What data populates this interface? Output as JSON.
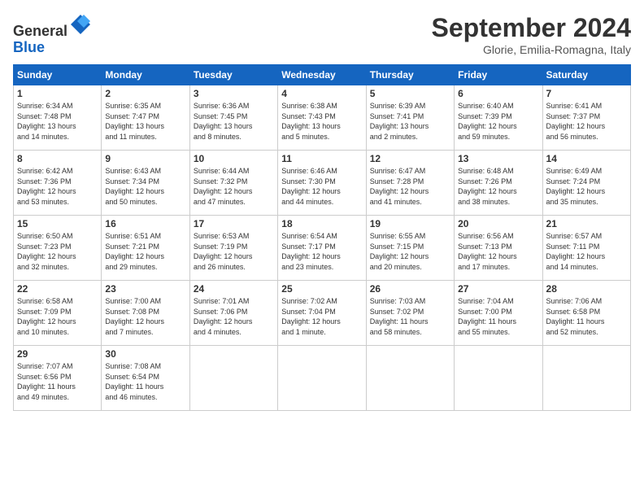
{
  "header": {
    "logo_line1": "General",
    "logo_line2": "Blue",
    "month": "September 2024",
    "location": "Glorie, Emilia-Romagna, Italy"
  },
  "days_of_week": [
    "Sunday",
    "Monday",
    "Tuesday",
    "Wednesday",
    "Thursday",
    "Friday",
    "Saturday"
  ],
  "weeks": [
    [
      {
        "day": "1",
        "info": "Sunrise: 6:34 AM\nSunset: 7:48 PM\nDaylight: 13 hours\nand 14 minutes."
      },
      {
        "day": "2",
        "info": "Sunrise: 6:35 AM\nSunset: 7:47 PM\nDaylight: 13 hours\nand 11 minutes."
      },
      {
        "day": "3",
        "info": "Sunrise: 6:36 AM\nSunset: 7:45 PM\nDaylight: 13 hours\nand 8 minutes."
      },
      {
        "day": "4",
        "info": "Sunrise: 6:38 AM\nSunset: 7:43 PM\nDaylight: 13 hours\nand 5 minutes."
      },
      {
        "day": "5",
        "info": "Sunrise: 6:39 AM\nSunset: 7:41 PM\nDaylight: 13 hours\nand 2 minutes."
      },
      {
        "day": "6",
        "info": "Sunrise: 6:40 AM\nSunset: 7:39 PM\nDaylight: 12 hours\nand 59 minutes."
      },
      {
        "day": "7",
        "info": "Sunrise: 6:41 AM\nSunset: 7:37 PM\nDaylight: 12 hours\nand 56 minutes."
      }
    ],
    [
      {
        "day": "8",
        "info": "Sunrise: 6:42 AM\nSunset: 7:36 PM\nDaylight: 12 hours\nand 53 minutes."
      },
      {
        "day": "9",
        "info": "Sunrise: 6:43 AM\nSunset: 7:34 PM\nDaylight: 12 hours\nand 50 minutes."
      },
      {
        "day": "10",
        "info": "Sunrise: 6:44 AM\nSunset: 7:32 PM\nDaylight: 12 hours\nand 47 minutes."
      },
      {
        "day": "11",
        "info": "Sunrise: 6:46 AM\nSunset: 7:30 PM\nDaylight: 12 hours\nand 44 minutes."
      },
      {
        "day": "12",
        "info": "Sunrise: 6:47 AM\nSunset: 7:28 PM\nDaylight: 12 hours\nand 41 minutes."
      },
      {
        "day": "13",
        "info": "Sunrise: 6:48 AM\nSunset: 7:26 PM\nDaylight: 12 hours\nand 38 minutes."
      },
      {
        "day": "14",
        "info": "Sunrise: 6:49 AM\nSunset: 7:24 PM\nDaylight: 12 hours\nand 35 minutes."
      }
    ],
    [
      {
        "day": "15",
        "info": "Sunrise: 6:50 AM\nSunset: 7:23 PM\nDaylight: 12 hours\nand 32 minutes."
      },
      {
        "day": "16",
        "info": "Sunrise: 6:51 AM\nSunset: 7:21 PM\nDaylight: 12 hours\nand 29 minutes."
      },
      {
        "day": "17",
        "info": "Sunrise: 6:53 AM\nSunset: 7:19 PM\nDaylight: 12 hours\nand 26 minutes."
      },
      {
        "day": "18",
        "info": "Sunrise: 6:54 AM\nSunset: 7:17 PM\nDaylight: 12 hours\nand 23 minutes."
      },
      {
        "day": "19",
        "info": "Sunrise: 6:55 AM\nSunset: 7:15 PM\nDaylight: 12 hours\nand 20 minutes."
      },
      {
        "day": "20",
        "info": "Sunrise: 6:56 AM\nSunset: 7:13 PM\nDaylight: 12 hours\nand 17 minutes."
      },
      {
        "day": "21",
        "info": "Sunrise: 6:57 AM\nSunset: 7:11 PM\nDaylight: 12 hours\nand 14 minutes."
      }
    ],
    [
      {
        "day": "22",
        "info": "Sunrise: 6:58 AM\nSunset: 7:09 PM\nDaylight: 12 hours\nand 10 minutes."
      },
      {
        "day": "23",
        "info": "Sunrise: 7:00 AM\nSunset: 7:08 PM\nDaylight: 12 hours\nand 7 minutes."
      },
      {
        "day": "24",
        "info": "Sunrise: 7:01 AM\nSunset: 7:06 PM\nDaylight: 12 hours\nand 4 minutes."
      },
      {
        "day": "25",
        "info": "Sunrise: 7:02 AM\nSunset: 7:04 PM\nDaylight: 12 hours\nand 1 minute."
      },
      {
        "day": "26",
        "info": "Sunrise: 7:03 AM\nSunset: 7:02 PM\nDaylight: 11 hours\nand 58 minutes."
      },
      {
        "day": "27",
        "info": "Sunrise: 7:04 AM\nSunset: 7:00 PM\nDaylight: 11 hours\nand 55 minutes."
      },
      {
        "day": "28",
        "info": "Sunrise: 7:06 AM\nSunset: 6:58 PM\nDaylight: 11 hours\nand 52 minutes."
      }
    ],
    [
      {
        "day": "29",
        "info": "Sunrise: 7:07 AM\nSunset: 6:56 PM\nDaylight: 11 hours\nand 49 minutes."
      },
      {
        "day": "30",
        "info": "Sunrise: 7:08 AM\nSunset: 6:54 PM\nDaylight: 11 hours\nand 46 minutes."
      },
      null,
      null,
      null,
      null,
      null
    ]
  ]
}
